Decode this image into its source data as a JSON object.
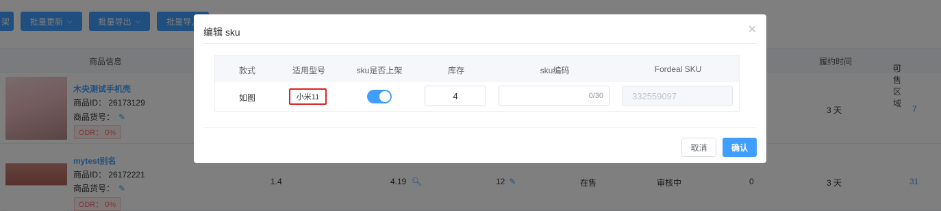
{
  "toolbar": {
    "first_label": "架",
    "batch_update": "批量更新",
    "batch_export": "批量导出",
    "batch_import": "批量导入"
  },
  "table_headers": {
    "product_info": "商品信息",
    "fulfill_time": "履约时间",
    "sellable_region": "可售区域"
  },
  "rows": [
    {
      "name": "木央测试手机壳",
      "id_label": "商品ID：",
      "id": "26173129",
      "sku_label": "商品货号：",
      "odr": "ODR：  0%",
      "fulfill": "3 天",
      "region": "7"
    },
    {
      "name": "mytest别名",
      "id_label": "商品ID：",
      "id": "26172221",
      "sku_label": "商品货号：",
      "odr": "ODR：  0%",
      "col_a": "1.4",
      "col_b": "4.19",
      "col_c": "12",
      "status": "在售",
      "review": "审核中",
      "col_d": "0",
      "fulfill": "3 天",
      "region": "31"
    }
  ],
  "dialog": {
    "title": "编辑 sku",
    "headers": {
      "style": "款式",
      "model": "适用型号",
      "onsale": "sku是否上架",
      "stock": "库存",
      "code": "sku编码",
      "fordeal": "Fordeal SKU"
    },
    "row": {
      "style": "如图",
      "model": "小米11",
      "onsale": true,
      "stock": "4",
      "code_counter": "0/30",
      "fordeal_sku": "332559097"
    },
    "cancel": "取消",
    "confirm": "确认"
  },
  "colors": {
    "primary": "#409eff",
    "highlight": "#e02020"
  }
}
